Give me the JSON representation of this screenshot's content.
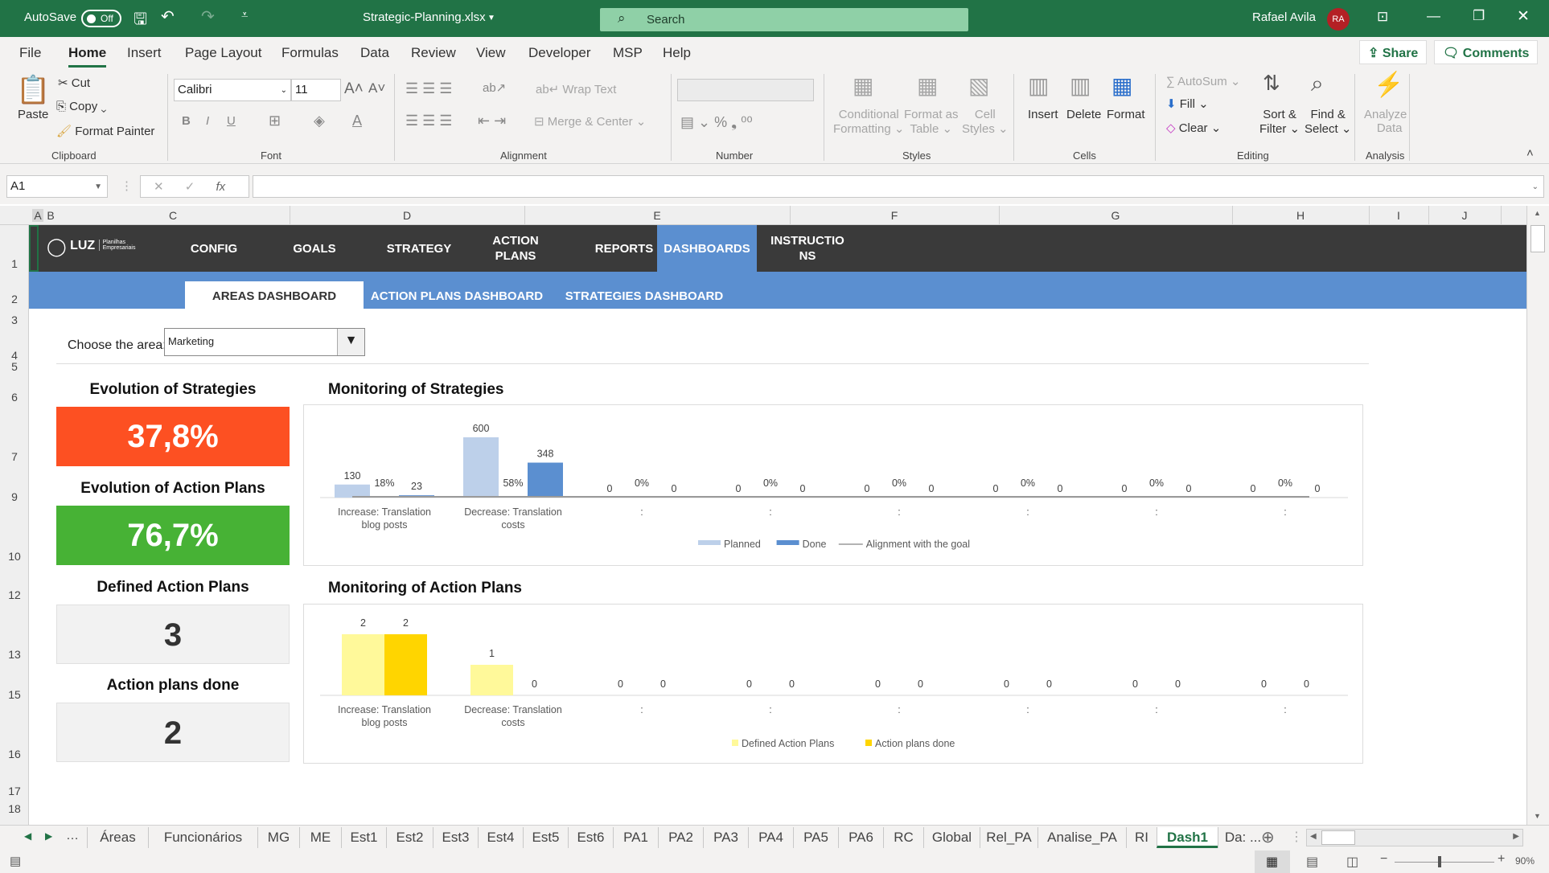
{
  "titlebar": {
    "autosave_label": "AutoSave",
    "autosave_state": "Off",
    "filename": "Strategic-Planning.xlsx",
    "search_placeholder": "Search",
    "user_name": "Rafael Avila",
    "user_initials": "RA"
  },
  "menu": {
    "items": [
      "File",
      "Home",
      "Insert",
      "Page Layout",
      "Formulas",
      "Data",
      "Review",
      "View",
      "Developer",
      "MSP",
      "Help"
    ],
    "active": "Home",
    "share_label": "Share",
    "comments_label": "Comments"
  },
  "ribbon": {
    "clipboard": {
      "paste": "Paste",
      "cut": "Cut",
      "copy": "Copy",
      "format_painter": "Format Painter",
      "group": "Clipboard"
    },
    "font": {
      "font_name": "Calibri",
      "font_size": "11",
      "group": "Font"
    },
    "alignment": {
      "wrap_text": "Wrap Text",
      "merge_center": "Merge & Center",
      "group": "Alignment"
    },
    "number": {
      "format": "",
      "group": "Number"
    },
    "styles": {
      "conditional": "Conditional",
      "conditional2": "Formatting",
      "format_as": "Format as",
      "format_as2": "Table",
      "cell": "Cell",
      "cell2": "Styles",
      "group": "Styles"
    },
    "cells": {
      "insert": "Insert",
      "delete": "Delete",
      "format": "Format",
      "group": "Cells"
    },
    "editing": {
      "autosum": "AutoSum",
      "fill": "Fill",
      "clear": "Clear",
      "sort": "Sort &",
      "sort2": "Filter",
      "find": "Find &",
      "find2": "Select",
      "group": "Editing"
    },
    "analysis": {
      "analyze": "Analyze",
      "analyze2": "Data",
      "group": "Analysis"
    }
  },
  "formula_bar": {
    "name_box": "A1",
    "formula": ""
  },
  "columns": [
    "A",
    "B",
    "C",
    "D",
    "E",
    "F",
    "G",
    "H",
    "I",
    "J"
  ],
  "rows": [
    "1",
    "2",
    "3",
    "4",
    "5",
    "6",
    "7",
    "9",
    "10",
    "12",
    "13",
    "15",
    "16",
    "17",
    "18"
  ],
  "dashboard": {
    "logo": "LUZ",
    "logo_sub": "Planilhas Empresariais",
    "nav": [
      "CONFIG",
      "GOALS",
      "STRATEGY",
      "ACTION PLANS",
      "REPORTS",
      "DASHBOARDS",
      "INSTRUCTIONS"
    ],
    "nav_active": "DASHBOARDS",
    "subnav": [
      "AREAS DASHBOARD",
      "ACTION PLANS DASHBOARD",
      "STRATEGIES DASHBOARD"
    ],
    "subnav_active": "AREAS DASHBOARD",
    "area_label": "Choose the area:",
    "area_value": "Marketing",
    "kpis": [
      {
        "title": "Evolution of Strategies",
        "value": "37,8%",
        "color": "#fd5022"
      },
      {
        "title": "Evolution of Action Plans",
        "value": "76,7%",
        "color": "#47b235"
      },
      {
        "title": "Defined Action Plans",
        "value": "3",
        "color": "#f2f2f2"
      },
      {
        "title": "Action plans done",
        "value": "2",
        "color": "#f2f2f2"
      }
    ]
  },
  "chart_data": [
    {
      "type": "bar",
      "title": "Monitoring of Strategies",
      "categories": [
        "Increase: Translation blog posts",
        "Decrease: Translation costs",
        ":",
        ":",
        ":",
        ":",
        ":",
        ":"
      ],
      "series": [
        {
          "name": "Planned",
          "color": "#bdd0ea",
          "values": [
            130,
            600,
            0,
            0,
            0,
            0,
            0,
            0
          ]
        },
        {
          "name": "Done",
          "color": "#5b8fd0",
          "values": [
            23,
            348,
            0,
            0,
            0,
            0,
            0,
            0
          ]
        },
        {
          "name": "Alignment with the goal",
          "type": "line",
          "color": "#9a9a9a",
          "labels": [
            "18%",
            "58%",
            "0%",
            "0%",
            "0%",
            "0%",
            "0%",
            "0%"
          ]
        }
      ],
      "legend": "bottom"
    },
    {
      "type": "bar",
      "title": "Monitoring of Action Plans",
      "categories": [
        "Increase: Translation blog posts",
        "Decrease: Translation costs",
        ":",
        ":",
        ":",
        ":",
        ":",
        ":"
      ],
      "series": [
        {
          "name": "Defined Action Plans",
          "color": "#fff99a",
          "values": [
            2,
            1,
            0,
            0,
            0,
            0,
            0,
            0
          ]
        },
        {
          "name": "Action plans done",
          "color": "#ffd500",
          "values": [
            2,
            0,
            0,
            0,
            0,
            0,
            0,
            0
          ]
        }
      ],
      "legend": "bottom"
    }
  ],
  "sheet_tabs": [
    "Áreas",
    "Funcionários",
    "MG",
    "ME",
    "Est1",
    "Est2",
    "Est3",
    "Est4",
    "Est5",
    "Est6",
    "PA1",
    "PA2",
    "PA3",
    "PA4",
    "PA5",
    "PA6",
    "RC",
    "Global",
    "Rel_PA",
    "Analise_PA",
    "RI",
    "Dash1",
    "Da: ..."
  ],
  "active_tab": "Dash1",
  "status": {
    "zoom": "90%"
  }
}
